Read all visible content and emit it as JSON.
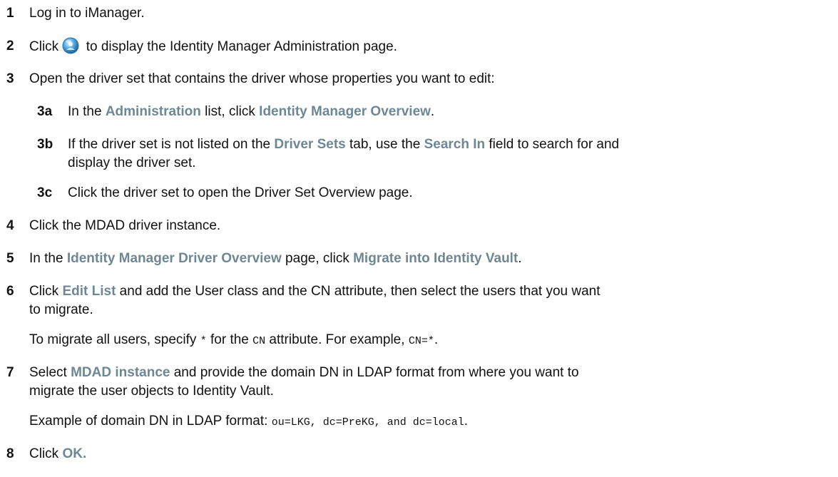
{
  "steps": {
    "s1": {
      "num": "1",
      "text": "Log in to iManager."
    },
    "s2": {
      "num": "2",
      "pre": "Click ",
      "post": " to display the Identity Manager Administration page.",
      "icon": "identity-manager-globe-icon"
    },
    "s3": {
      "num": "3",
      "text": "Open the driver set that contains the driver whose properties you want to edit:"
    },
    "s3a": {
      "num": "3a",
      "t1": "In the ",
      "ui1": "Administration",
      "t2": " list, click ",
      "ui2": "Identity Manager Overview",
      "t3": "."
    },
    "s3b": {
      "num": "3b",
      "t1": "If the driver set is not listed on the ",
      "ui1": "Driver Sets",
      "t2": " tab, use the ",
      "ui2": "Search In",
      "t3": " field to search for and",
      "line2": "display the driver set."
    },
    "s3c": {
      "num": "3c",
      "text": "Click the driver set to open the Driver Set Overview page."
    },
    "s4": {
      "num": "4",
      "text": "Click the MDAD driver instance."
    },
    "s5": {
      "num": "5",
      "t1": "In the ",
      "ui1": "Identity Manager Driver Overview",
      "t2": " page, click ",
      "ui2": "Migrate into Identity Vault",
      "t3": "."
    },
    "s6": {
      "num": "6",
      "t0": "Click ",
      "ui1": "Edit List",
      "t1": " and add the User class and the CN attribute, then select the users that you want",
      "line2": "to migrate."
    },
    "s6note": {
      "t1": "To migrate all users, specify ",
      "c1": "*",
      "t2": " for the ",
      "c2": "CN",
      "t3": " attribute. For example, ",
      "c3": "CN=*",
      "t4": "."
    },
    "s7": {
      "num": "7",
      "t0": "Select ",
      "ui1": "MDAD instance",
      "t1": " and provide the domain DN in LDAP format from where you want to",
      "line2": "migrate the user objects to Identity Vault."
    },
    "s7note": {
      "t1": "Example of domain DN in LDAP format: ",
      "c1": "ou=LKG, dc=PreKG, and dc=local",
      "t2": "."
    },
    "s8": {
      "num": "8",
      "t0": "Click ",
      "ui1": "OK."
    }
  },
  "colors": {
    "ui_term": "#6e8794",
    "text": "#111111"
  }
}
